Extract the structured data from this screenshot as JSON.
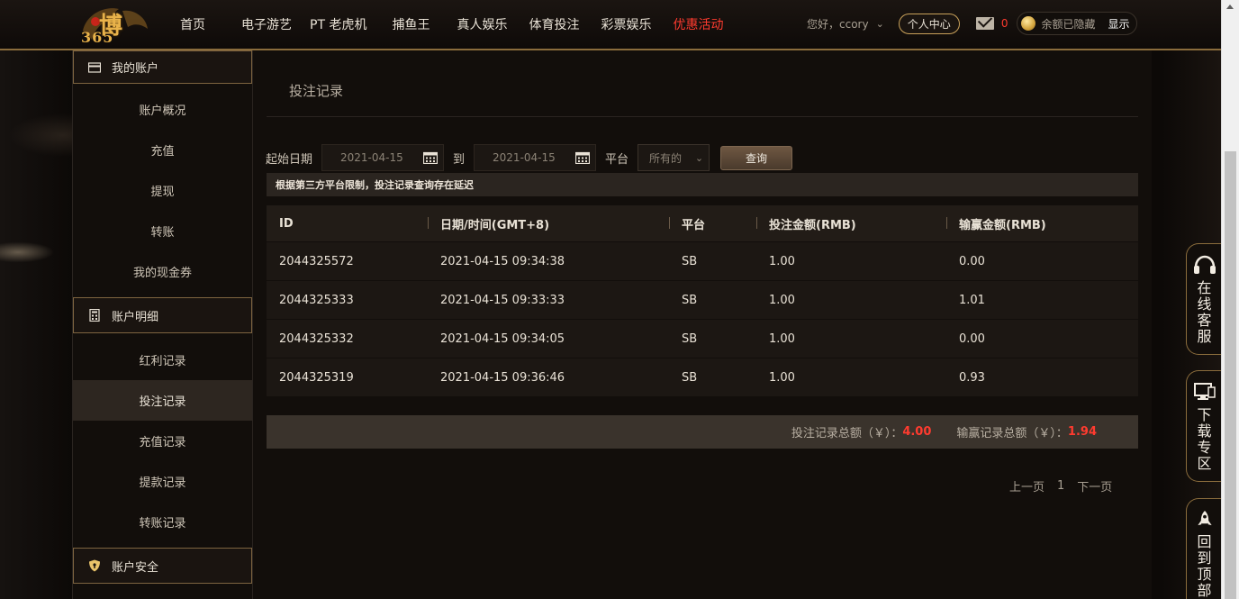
{
  "header": {
    "logo_text": "博",
    "logo_num": "365",
    "nav": [
      "首页",
      "电子游艺",
      "PT 老虎机",
      "捕鱼王",
      "真人娱乐",
      "体育投注",
      "彩票娱乐",
      "优惠活动"
    ],
    "greeting": "您好，ccory",
    "personal_center": "个人中心",
    "mail_count": "0",
    "balance_hidden": "余额已隐藏",
    "show": "显示"
  },
  "sidebar": {
    "sections": [
      {
        "title": "我的账户",
        "items": [
          "账户概况",
          "充值",
          "提现",
          "转账",
          "我的现金券"
        ]
      },
      {
        "title": "账户明细",
        "items": [
          "红利记录",
          "投注记录",
          "充值记录",
          "提款记录",
          "转账记录"
        ]
      },
      {
        "title": "账户安全",
        "items": []
      }
    ],
    "active_item": "投注记录"
  },
  "main": {
    "title": "投注记录",
    "filter": {
      "start_label": "起始日期",
      "start_date": "2021-04-15",
      "to_label": "到",
      "end_date": "2021-04-15",
      "platform_label": "平台",
      "platform_value": "所有的",
      "query_button": "查询"
    },
    "notice": "根据第三方平台限制，投注记录查询存在延迟",
    "table": {
      "headers": [
        "ID",
        "日期/时间(GMT+8)",
        "平台",
        "投注金额(RMB)",
        "输赢金额(RMB)"
      ],
      "rows": [
        [
          "2044325572",
          "2021-04-15 09:34:38",
          "SB",
          "1.00",
          "0.00"
        ],
        [
          "2044325333",
          "2021-04-15 09:33:33",
          "SB",
          "1.00",
          "1.01"
        ],
        [
          "2044325332",
          "2021-04-15 09:34:05",
          "SB",
          "1.00",
          "0.00"
        ],
        [
          "2044325319",
          "2021-04-15 09:36:46",
          "SB",
          "1.00",
          "0.93"
        ]
      ]
    },
    "summary": {
      "bet_label": "投注记录总额（￥）：",
      "bet_total": "4.00",
      "win_label": "输赢记录总额（￥）：",
      "win_total": "1.94"
    },
    "pager": {
      "prev": "上一页",
      "page": "1",
      "next": "下一页"
    }
  },
  "float": {
    "service": "在线客服",
    "download": "下载专区",
    "top": "回到顶部"
  },
  "colors": {
    "accent_gold": "#c9a15a",
    "promo_red": "#ff3b2f"
  }
}
